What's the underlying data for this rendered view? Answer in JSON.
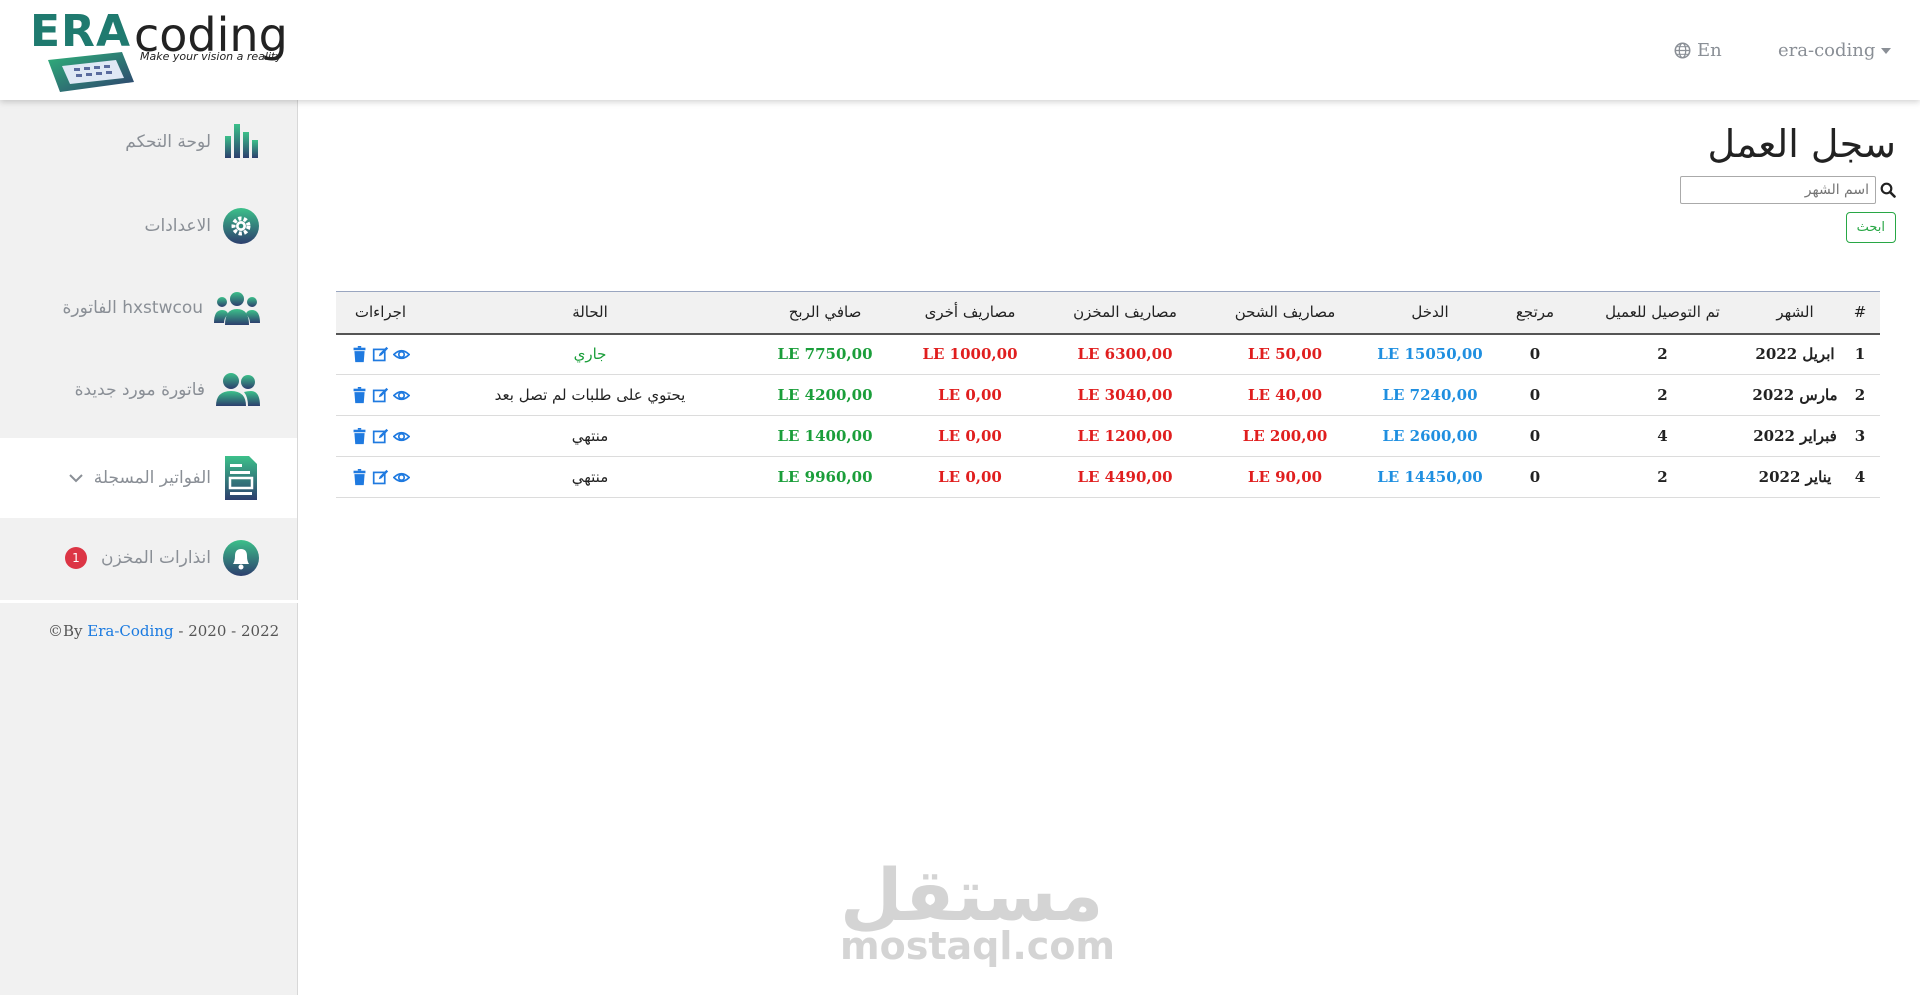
{
  "brand": {
    "logo_era": "ERA",
    "logo_coding": "coding",
    "tagline": "Make your vision a reality"
  },
  "navbar": {
    "language": "En",
    "user": "era-coding"
  },
  "sidebar": {
    "items": [
      {
        "label": "لوحة التحكم",
        "icon": "bar-chart-icon"
      },
      {
        "label": "الاعدادات",
        "icon": "gear-icon"
      },
      {
        "label": "الفاتورة hxstwcou",
        "icon": "users-group-icon"
      },
      {
        "label": "فاتورة مورد جديدة",
        "icon": "users-pair-icon"
      },
      {
        "label": "الفواتير المسجلة",
        "icon": "invoice-file-icon"
      },
      {
        "label": "انذارات المخزن",
        "icon": "bell-icon",
        "badge": "1"
      }
    ],
    "footer": {
      "prefix": "©By",
      "link": "Era-Coding",
      "years": "- 2020 - 2022"
    }
  },
  "main": {
    "title": "سجل العمل",
    "search_placeholder": "اسم الشهر",
    "search_button": "ابحث"
  },
  "table": {
    "headers": [
      "#",
      "الشهر",
      "تم التوصيل للعميل",
      "مرتجع",
      "الدخل",
      "مصاريف الشحن",
      "مصاريف المخزن",
      "مصاريف أخرى",
      "صافي الربح",
      "الحالة",
      "اجراءات"
    ],
    "rows": [
      {
        "num": "1",
        "month": "ابريل 2022",
        "delivered": "2",
        "returned": "0",
        "income": "LE 15050,00",
        "shipping": "LE 50,00",
        "storage": "LE 6300,00",
        "other": "LE 1000,00",
        "profit": "LE 7750,00",
        "status": "جاري",
        "status_color": "#1a9e3a"
      },
      {
        "num": "2",
        "month": "مارس 2022",
        "delivered": "2",
        "returned": "0",
        "income": "LE 7240,00",
        "shipping": "LE 40,00",
        "storage": "LE 3040,00",
        "other": "LE 0,00",
        "profit": "LE 4200,00",
        "status": "يحتوي على طلبات لم تصل بعد",
        "status_color": "#222222"
      },
      {
        "num": "3",
        "month": "فبراير 2022",
        "delivered": "4",
        "returned": "0",
        "income": "LE 2600,00",
        "shipping": "LE 200,00",
        "storage": "LE 1200,00",
        "other": "LE 0,00",
        "profit": "LE 1400,00",
        "status": "منتهي",
        "status_color": "#222222"
      },
      {
        "num": "4",
        "month": "يناير 2022",
        "delivered": "2",
        "returned": "0",
        "income": "LE 14450,00",
        "shipping": "LE 90,00",
        "storage": "LE 4490,00",
        "other": "LE 0,00",
        "profit": "LE 9960,00",
        "status": "منتهي",
        "status_color": "#222222"
      }
    ]
  },
  "watermark": {
    "arabic": "مستقل",
    "latin": "mostaql.com"
  },
  "colors": {
    "accent_green": "#28a745",
    "income_blue": "#1f8fe0",
    "expense_red": "#e01e1e",
    "profit_green": "#1a9e3a",
    "badge_red": "#dc3545"
  }
}
